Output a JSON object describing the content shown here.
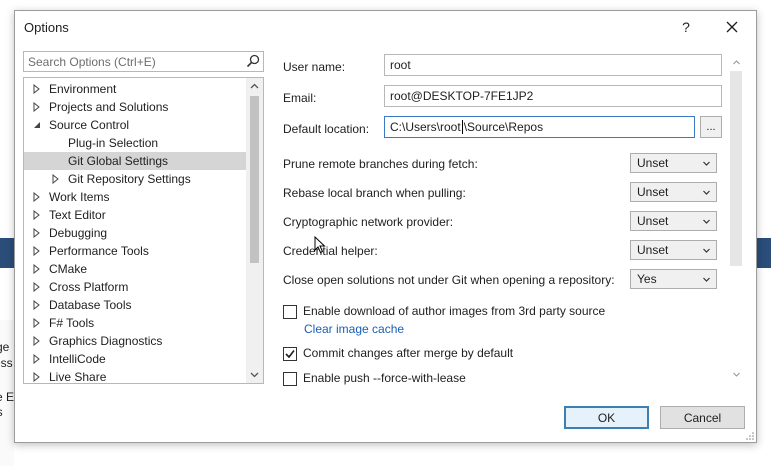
{
  "background": {
    "fragments": [
      "ge",
      "ess",
      "e E",
      "is"
    ]
  },
  "dialog": {
    "title": "Options",
    "help_glyph": "?",
    "close_glyph": "✕"
  },
  "search": {
    "placeholder": "Search Options (Ctrl+E)",
    "value": ""
  },
  "tree": {
    "items": [
      {
        "label": "Environment",
        "expander": "collapsed"
      },
      {
        "label": "Projects and Solutions",
        "expander": "collapsed"
      },
      {
        "label": "Source Control",
        "expander": "expanded"
      },
      {
        "label": "Plug-in Selection",
        "expander": "none"
      },
      {
        "label": "Git Global Settings",
        "expander": "none",
        "selected": true
      },
      {
        "label": "Git Repository Settings",
        "expander": "collapsed"
      },
      {
        "label": "Work Items",
        "expander": "collapsed"
      },
      {
        "label": "Text Editor",
        "expander": "collapsed"
      },
      {
        "label": "Debugging",
        "expander": "collapsed"
      },
      {
        "label": "Performance Tools",
        "expander": "collapsed"
      },
      {
        "label": "CMake",
        "expander": "collapsed"
      },
      {
        "label": "Cross Platform",
        "expander": "collapsed"
      },
      {
        "label": "Database Tools",
        "expander": "collapsed"
      },
      {
        "label": "F# Tools",
        "expander": "collapsed"
      },
      {
        "label": "Graphics Diagnostics",
        "expander": "collapsed"
      },
      {
        "label": "IntelliCode",
        "expander": "collapsed"
      },
      {
        "label": "Live Share",
        "expander": "collapsed"
      }
    ]
  },
  "settings": {
    "user_name_label": "User name:",
    "user_name_value": "root",
    "email_label": "Email:",
    "email_value": "root@DESKTOP-7FE1JP2",
    "default_location_label": "Default location:",
    "default_location_before_caret": "C:\\Users\\root",
    "default_location_after_caret": "\\Source\\Repos",
    "browse_label": "...",
    "prune_label": "Prune remote branches during fetch:",
    "prune_value": "Unset",
    "rebase_label": "Rebase local branch when pulling:",
    "rebase_value": "Unset",
    "crypto_label": "Cryptographic network provider:",
    "crypto_value": "Unset",
    "credential_label": "Credential helper:",
    "credential_value": "Unset",
    "close_solutions_label": "Close open solutions not under Git when opening a repository:",
    "close_solutions_value": "Yes",
    "author_images_label": "Enable download of author images from 3rd party source",
    "author_images_checked": false,
    "clear_cache_link": "Clear image cache",
    "commit_after_merge_label": "Commit changes after merge by default",
    "commit_after_merge_checked": true,
    "force_with_lease_label": "Enable push --force-with-lease",
    "force_with_lease_checked": false
  },
  "buttons": {
    "ok": "OK",
    "cancel": "Cancel"
  },
  "colors": {
    "accent": "#3c7fb1",
    "link": "#1a5fb4",
    "selection": "#d5d5d5"
  }
}
